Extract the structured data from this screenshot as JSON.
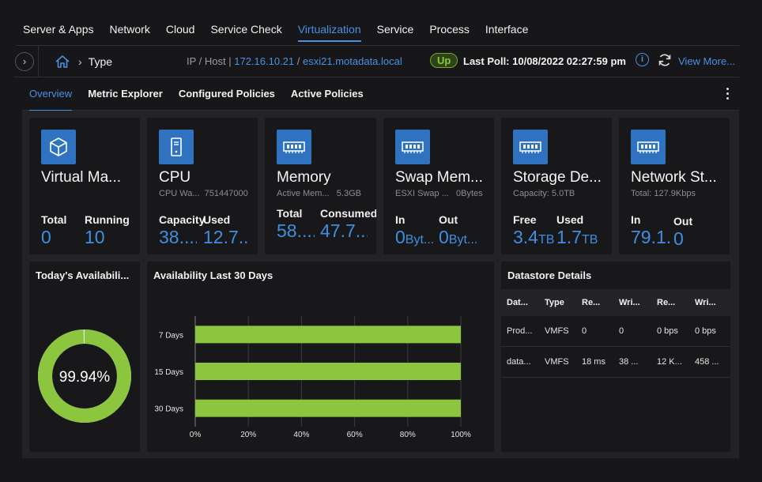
{
  "nav": {
    "tabs": [
      "Server & Apps",
      "Network",
      "Cloud",
      "Service Check",
      "Virtualization",
      "Service",
      "Process",
      "Interface"
    ],
    "active": 4
  },
  "breadcrumb": {
    "type": "Type",
    "ip_host_label": "IP / Host |",
    "ip": "172.16.10.21",
    "separator": "/",
    "host": "esxi21.motadata.local",
    "status": "Up",
    "last_poll": "Last Poll: 10/08/2022 02:27:59 pm",
    "view_more": "View More..."
  },
  "subtabs": {
    "items": [
      "Overview",
      "Metric Explorer",
      "Configured Policies",
      "Active Policies"
    ],
    "active": 0
  },
  "cards": {
    "vm": {
      "title": "Virtual Ma...",
      "l1": "Total",
      "v1": "0",
      "l2": "Running",
      "v2": "10"
    },
    "cpu": {
      "title": "CPU",
      "sub_label": "CPU Wa...",
      "sub_value": "751447000",
      "l1": "Capacity",
      "v1": "38....",
      "l2": "Used",
      "v2": "12.7..."
    },
    "memory": {
      "title": "Memory",
      "sub_label": "Active Mem...",
      "sub_value": "5.3GB",
      "l1": "Total",
      "v1": "58....",
      "l2": "Consumed",
      "v2": "47.7..."
    },
    "swap": {
      "title": "Swap Mem...",
      "sub_label": "ESXI Swap ...",
      "sub_value": "0Bytes",
      "l1": "In",
      "v1": "0",
      "u1": "Byt...",
      "l2": "Out",
      "v2": "0",
      "u2": "Byt..."
    },
    "storage": {
      "title": "Storage De...",
      "sub_label": "Capacity: 5.0TB",
      "l1": "Free",
      "v1": "3.4",
      "u1": "TB",
      "l2": "Used",
      "v2": "1.7",
      "u2": "TB"
    },
    "network": {
      "title": "Network St...",
      "sub_label": "Total: 127.9Kbps",
      "l1": "In",
      "v1": "79.1...",
      "l2": "Out",
      "v2": "0"
    }
  },
  "availability_today": {
    "title": "Today's Availabili...",
    "percent": 99.94,
    "label": "99.94%",
    "colors": {
      "ok": "#8cc63f",
      "down": "#e4e4e4"
    }
  },
  "availability_30": {
    "title": "Availability Last 30 Days"
  },
  "chart_data": {
    "type": "bar",
    "orientation": "horizontal",
    "categories": [
      "7 Days",
      "15 Days",
      "30 Days"
    ],
    "values": [
      100,
      100,
      100
    ],
    "xlim": [
      0,
      100
    ],
    "xticks": [
      "0%",
      "20%",
      "40%",
      "60%",
      "80%",
      "100%"
    ],
    "grid": true,
    "color": "#8cc63f"
  },
  "datastore": {
    "title": "Datastore Details",
    "columns": [
      "Dat...",
      "Type",
      "Re...",
      "Wri...",
      "Re...",
      "Wri..."
    ],
    "rows": [
      [
        "Prod...",
        "VMFS",
        "0",
        "0",
        "0 bps",
        "0 bps"
      ],
      [
        "data...",
        "VMFS",
        "18 ms",
        "38 ...",
        "12 K...",
        "458 ..."
      ]
    ]
  }
}
